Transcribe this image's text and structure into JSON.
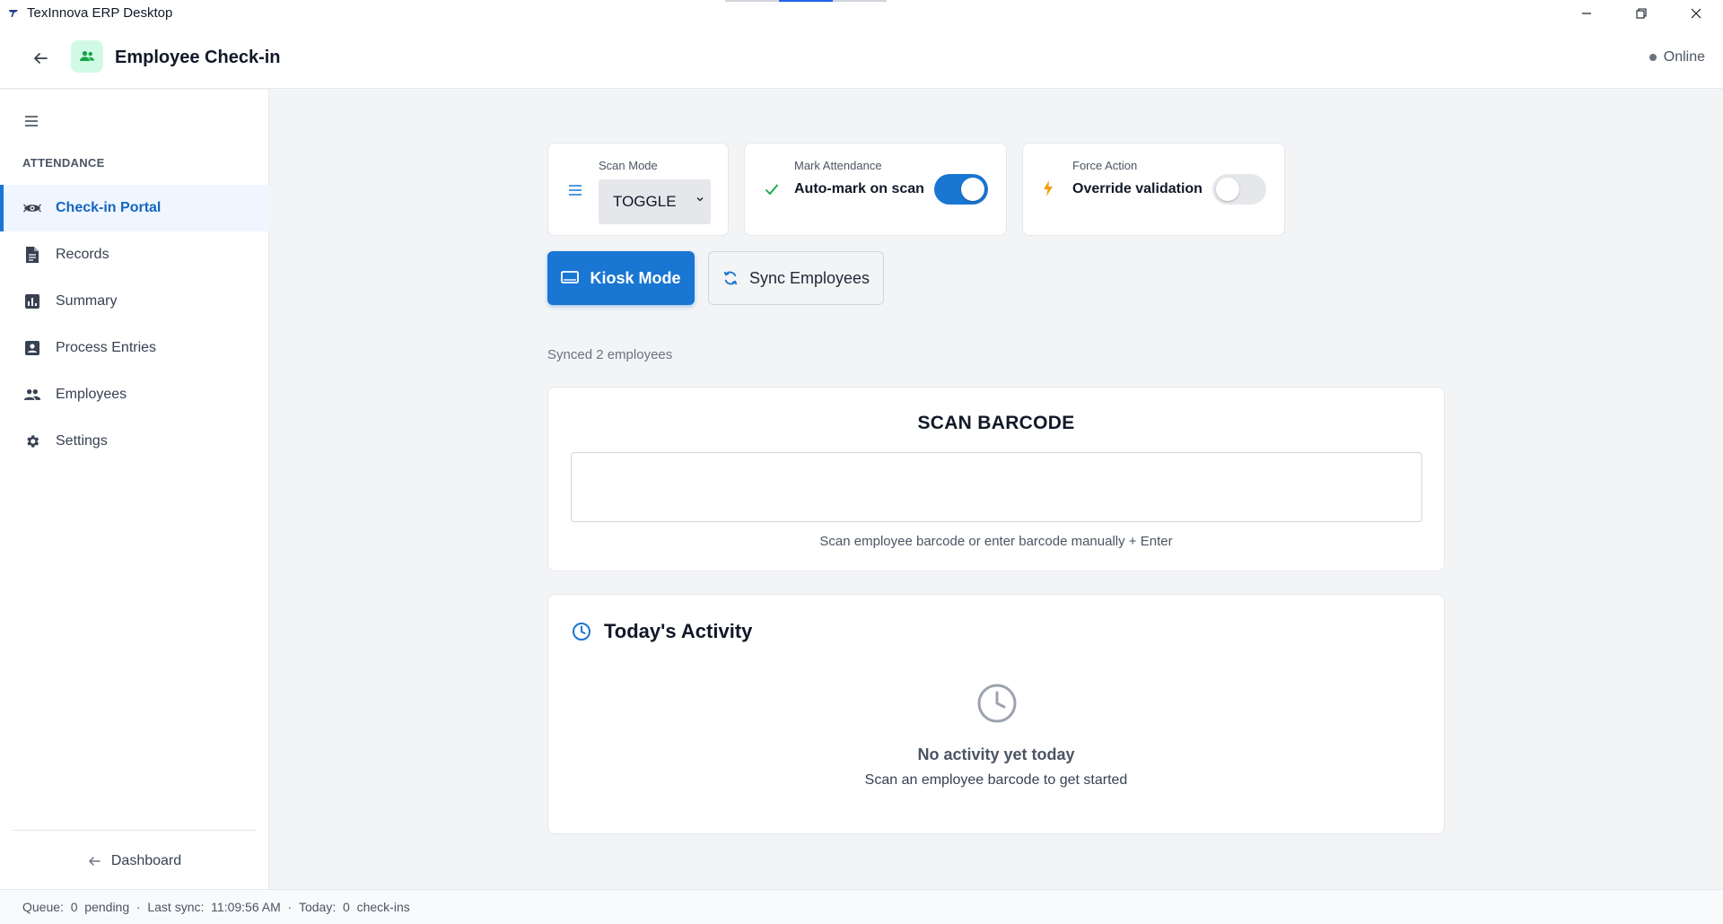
{
  "window": {
    "title": "TexInnova ERP Desktop",
    "controls": {
      "minimize": "—",
      "restore": "❐",
      "close": "✕"
    }
  },
  "header": {
    "title": "Employee Check-in",
    "icon": "people-icon",
    "status": "Online",
    "colors": {
      "icon_bg": "#d1fae5",
      "icon": "#16a34a"
    }
  },
  "sidebar": {
    "section_label": "ATTENDANCE",
    "items": [
      {
        "label": "Check-in Portal",
        "icon": "eye-scan-icon",
        "active": true
      },
      {
        "label": "Records",
        "icon": "document-icon",
        "active": false
      },
      {
        "label": "Summary",
        "icon": "bar-chart-icon",
        "active": false
      },
      {
        "label": "Process Entries",
        "icon": "contact-card-icon",
        "active": false
      },
      {
        "label": "Employees",
        "icon": "people-icon",
        "active": false
      },
      {
        "label": "Settings",
        "icon": "gear-icon",
        "active": false
      }
    ],
    "footer_link": "Dashboard"
  },
  "controls": {
    "scan_mode": {
      "caption": "Scan Mode",
      "value": "TOGGLE"
    },
    "mark_attendance": {
      "caption": "Mark Attendance",
      "label": "Auto-mark on scan",
      "enabled": true
    },
    "force_action": {
      "caption": "Force Action",
      "label": "Override validation",
      "enabled": false
    }
  },
  "actions": {
    "kiosk_label": "Kiosk Mode",
    "sync_label": "Sync Employees",
    "sync_status": "Synced 2 employees"
  },
  "scan": {
    "title": "SCAN BARCODE",
    "input_value": "",
    "hint": "Scan employee barcode or enter barcode manually + Enter"
  },
  "activity": {
    "title": "Today's Activity",
    "empty_title": "No activity yet today",
    "empty_subtitle": "Scan an employee barcode to get started"
  },
  "statusbar": {
    "queue_label": "Queue:",
    "queue_count": "0",
    "queue_suffix": "pending",
    "sync_label": "Last sync:",
    "sync_time": "11:09:56 AM",
    "today_label": "Today:",
    "today_count": "0",
    "today_suffix": "check-ins"
  },
  "colors": {
    "primary": "#1976d2",
    "active_bg": "#eff6ff",
    "bolt": "#f59e0b",
    "check": "#16a34a"
  }
}
